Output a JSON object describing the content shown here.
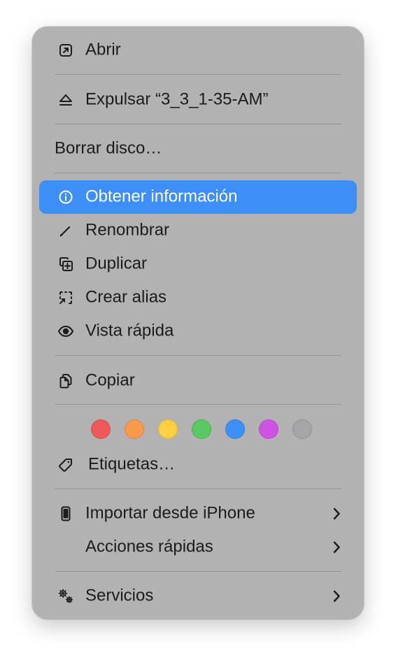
{
  "menu": {
    "items": {
      "abrir": {
        "label": "Abrir",
        "icon": "open-arrow-icon"
      },
      "expulsar": {
        "label": "Expulsar “3_3_1-35-AM”",
        "icon": "eject-icon"
      },
      "borrar": {
        "label": "Borrar disco…"
      },
      "obtener_info": {
        "label": "Obtener información",
        "icon": "info-icon",
        "selected": true
      },
      "renombrar": {
        "label": "Renombrar",
        "icon": "pencil-icon"
      },
      "duplicar": {
        "label": "Duplicar",
        "icon": "duplicate-icon"
      },
      "alias": {
        "label": "Crear alias",
        "icon": "alias-icon"
      },
      "vista_rapida": {
        "label": "Vista rápida",
        "icon": "eye-icon"
      },
      "copiar": {
        "label": "Copiar",
        "icon": "copy-icon"
      },
      "etiquetas": {
        "label": "Etiquetas…",
        "icon": "tag-icon"
      },
      "importar": {
        "label": "Importar desde iPhone",
        "icon": "iphone-icon",
        "submenu": true
      },
      "acciones": {
        "label": "Acciones rápidas",
        "submenu": true
      },
      "servicios": {
        "label": "Servicios",
        "icon": "gears-icon",
        "submenu": true
      }
    },
    "tag_colors": [
      {
        "name": "red",
        "hex": "#f0595a"
      },
      {
        "name": "orange",
        "hex": "#f79a4a"
      },
      {
        "name": "yellow",
        "hex": "#fbd142"
      },
      {
        "name": "green",
        "hex": "#5ac864"
      },
      {
        "name": "blue",
        "hex": "#3e8ff7"
      },
      {
        "name": "purple",
        "hex": "#d052e4"
      },
      {
        "name": "gray",
        "hex": "#a5a5a8"
      }
    ],
    "accent_color": "#3d8ef7",
    "background_color": "#b2b2b2"
  }
}
